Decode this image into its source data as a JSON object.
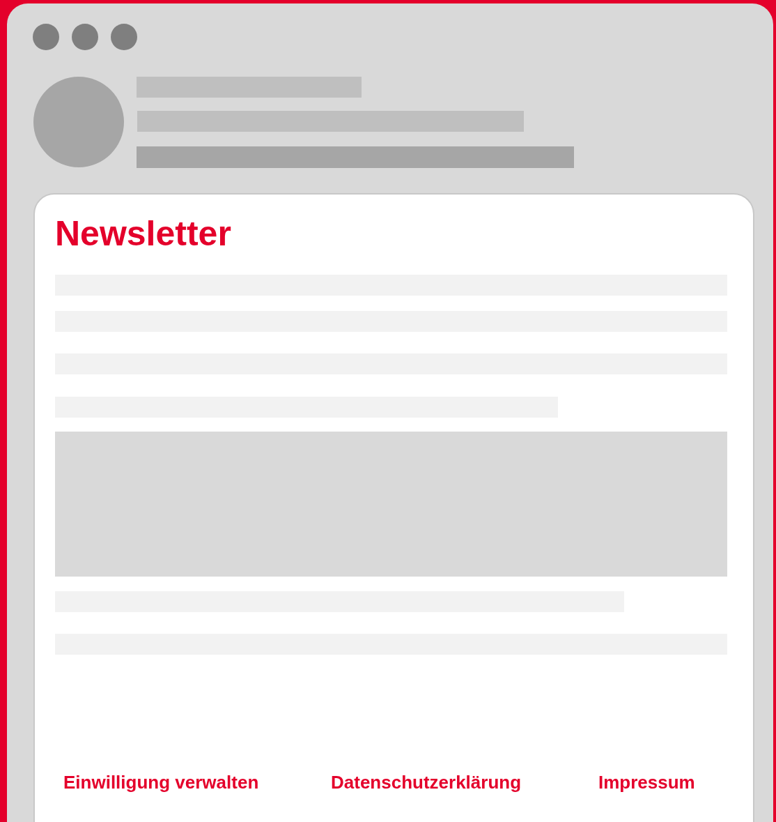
{
  "newsletter": {
    "title": "Newsletter",
    "footer_links": [
      "Einwilligung verwalten",
      "Datenschutzerklärung",
      "Impressum"
    ]
  }
}
